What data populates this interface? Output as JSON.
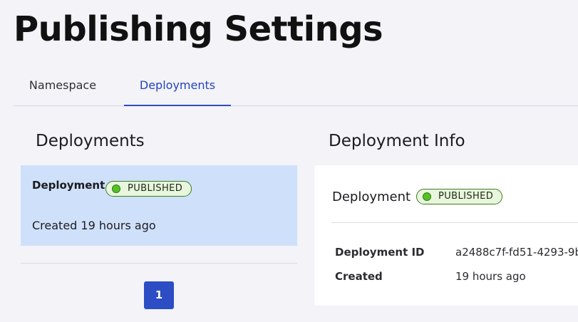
{
  "page": {
    "title": "Publishing Settings"
  },
  "tabs": [
    {
      "label": "Namespace",
      "active": false
    },
    {
      "label": "Deployments",
      "active": true
    }
  ],
  "deployments": {
    "title": "Deployments",
    "items": [
      {
        "name": "Deployment",
        "status": "PUBLISHED",
        "created": "Created 19 hours ago",
        "selected": true
      }
    ],
    "pagination": {
      "current_page": "1"
    }
  },
  "info": {
    "title": "Deployment Info",
    "name": "Deployment",
    "status": "PUBLISHED",
    "fields": [
      {
        "label": "Deployment ID",
        "value": "a2488c7f-fd51-4293-9b"
      },
      {
        "label": "Created",
        "value": "19 hours ago"
      }
    ]
  },
  "colors": {
    "accent": "#2c4dc4",
    "selected_bg": "#cfe0fa",
    "status_published": "#56c026",
    "background": "#f3f3f8"
  },
  "icons": {
    "status_dot": "status-dot-icon"
  }
}
